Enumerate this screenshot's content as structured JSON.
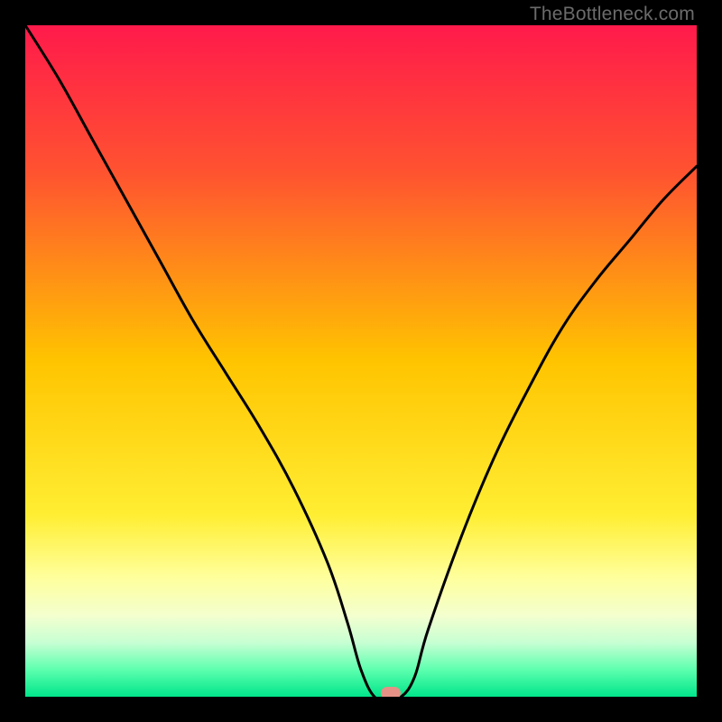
{
  "watermark": "TheBottleneck.com",
  "chart_data": {
    "type": "line",
    "title": "",
    "xlabel": "",
    "ylabel": "",
    "xlim": [
      0,
      100
    ],
    "ylim": [
      0,
      100
    ],
    "grid": false,
    "legend": false,
    "background_gradient_stops": [
      {
        "pct": 0,
        "color": "#ff1a4b"
      },
      {
        "pct": 22,
        "color": "#ff5330"
      },
      {
        "pct": 50,
        "color": "#ffc400"
      },
      {
        "pct": 73,
        "color": "#ffee33"
      },
      {
        "pct": 82,
        "color": "#ffff9a"
      },
      {
        "pct": 88,
        "color": "#f3ffcf"
      },
      {
        "pct": 92,
        "color": "#c6ffd3"
      },
      {
        "pct": 96,
        "color": "#5cffae"
      },
      {
        "pct": 100,
        "color": "#00e58a"
      }
    ],
    "series": [
      {
        "name": "bottleneck-curve",
        "color": "#000000",
        "x": [
          0,
          5,
          10,
          15,
          20,
          25,
          30,
          35,
          40,
          45,
          48,
          50,
          52,
          54,
          56,
          58,
          60,
          65,
          70,
          75,
          80,
          85,
          90,
          95,
          100
        ],
        "y": [
          100,
          92,
          83,
          74,
          65,
          56,
          48,
          40,
          31,
          20,
          11,
          4,
          0,
          0,
          0,
          3,
          10,
          24,
          36,
          46,
          55,
          62,
          68,
          74,
          79
        ]
      }
    ],
    "marker": {
      "x": 54.5,
      "y": 0.5,
      "color": "#e69186"
    }
  }
}
